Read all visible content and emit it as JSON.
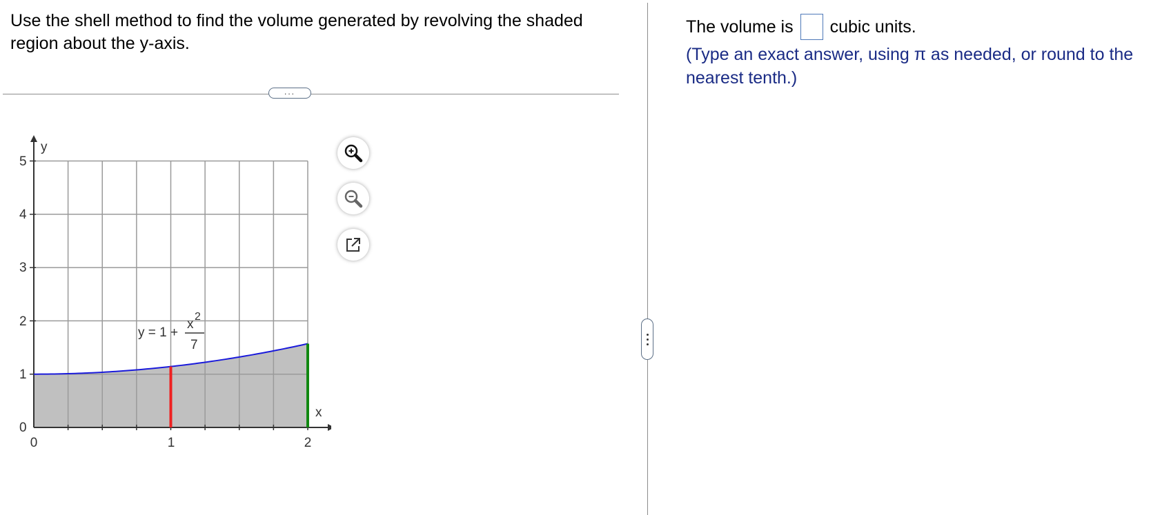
{
  "question": {
    "text": "Use the shell method to find the volume generated by revolving the shaded region about the y-axis."
  },
  "toolbar": {
    "more_label": "...",
    "zoom_in_icon": "zoom-in-icon",
    "zoom_out_icon": "zoom-out-icon",
    "popout_icon": "popout-icon"
  },
  "graph": {
    "y_axis_label": "y",
    "x_axis_label": "x",
    "y_ticks": [
      "5",
      "4",
      "3",
      "2",
      "1",
      "0"
    ],
    "x_ticks": [
      "0",
      "1",
      "2"
    ],
    "equation": {
      "prefix": "y = 1 +",
      "numerator": "x",
      "exponent": "2",
      "denominator": "7"
    },
    "colors": {
      "curve": "#1a1adb",
      "shade": "#c0c0c0",
      "red_line": "#ee2020",
      "green_line": "#118811",
      "grid": "#9a9a9a"
    }
  },
  "answer": {
    "prefix": "The volume is",
    "value": "",
    "suffix": "cubic units.",
    "hint": "(Type an exact answer, using π as needed, or round to the nearest tenth.)"
  }
}
